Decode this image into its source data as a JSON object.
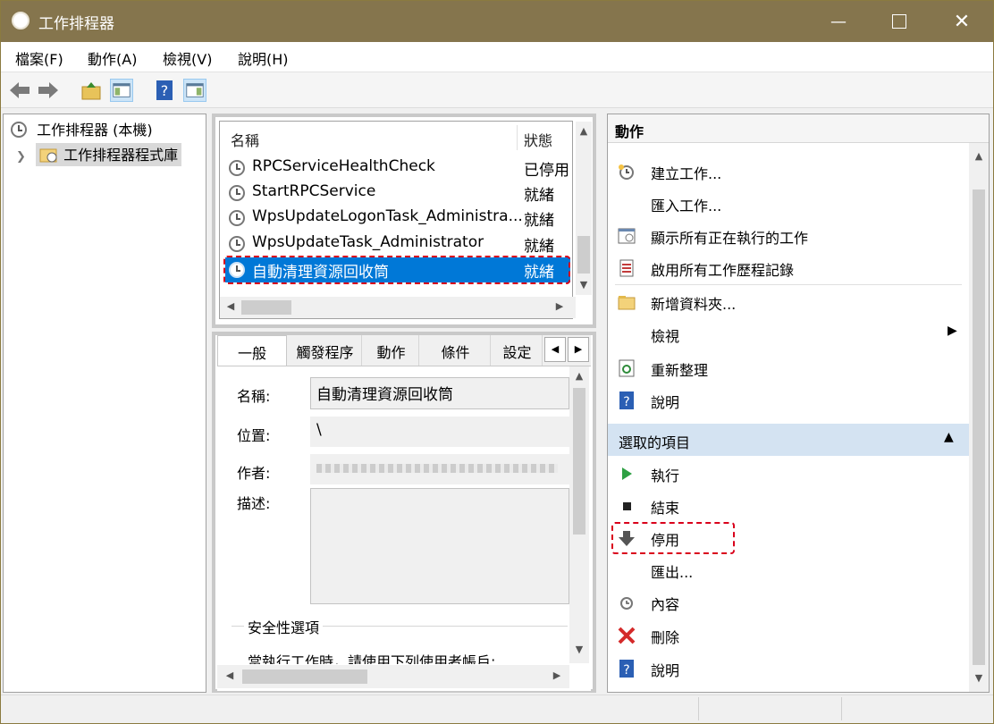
{
  "window": {
    "title": "工作排程器"
  },
  "menu": [
    "檔案(F)",
    "動作(A)",
    "檢視(V)",
    "說明(H)"
  ],
  "tree": {
    "root": "工作排程器 (本機)",
    "child": "工作排程器程式庫"
  },
  "tasks": {
    "col_name": "名稱",
    "col_status": "狀態",
    "rows": [
      {
        "name": "RPCServiceHealthCheck",
        "status": "已停用"
      },
      {
        "name": "StartRPCService",
        "status": "就緒"
      },
      {
        "name": "WpsUpdateLogonTask_Administra...",
        "status": "就緒"
      },
      {
        "name": "WpsUpdateTask_Administrator",
        "status": "就緒"
      },
      {
        "name": "自動清理資源回收筒",
        "status": "就緒"
      }
    ]
  },
  "details": {
    "tabs": [
      "一般",
      "觸發程序",
      "動作",
      "條件",
      "設定"
    ],
    "name_label": "名稱:",
    "name_value": "自動清理資源回收筒",
    "location_label": "位置:",
    "location_value": "\\",
    "author_label": "作者:",
    "desc_label": "描述:",
    "security_title": "安全性選項",
    "security_text": "當執行工作時，請使用下列使用者帳戶:"
  },
  "actions": {
    "header": "動作",
    "items": [
      "建立工作...",
      "匯入工作...",
      "顯示所有正在執行的工作",
      "啟用所有工作歷程記錄",
      "新增資料夾...",
      "檢視",
      "重新整理",
      "說明"
    ],
    "section": "選取的項目",
    "selected_items": [
      "執行",
      "結束",
      "停用",
      "匯出...",
      "內容",
      "刪除",
      "說明"
    ]
  },
  "colors": {
    "titlebar": "#85754d",
    "selection": "#0078d7",
    "highlight_dash": "#d9001b",
    "section_bg": "#d4e3f2"
  }
}
